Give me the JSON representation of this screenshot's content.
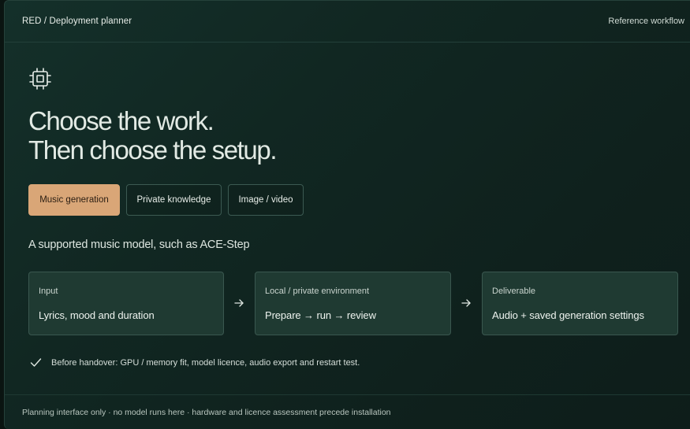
{
  "header": {
    "brand": "RED / Deployment planner",
    "nav_link": "Reference workflow"
  },
  "icons": {
    "hero": "cpu-chip-icon",
    "flow_arrow": "arrow-right-icon",
    "check": "checkmark-icon"
  },
  "hero": {
    "line1": "Choose the work.",
    "line2": "Then choose the setup."
  },
  "tabs": [
    {
      "label": "Music generation",
      "active": true
    },
    {
      "label": "Private knowledge",
      "active": false
    },
    {
      "label": "Image / video",
      "active": false
    }
  ],
  "model_line": "A supported music model, such as ACE-Step",
  "flow": [
    {
      "label": "Input",
      "value": "Lyrics, mood and duration"
    },
    {
      "label": "Local / private environment",
      "value": "Prepare → run → review"
    },
    {
      "label": "Deliverable",
      "value": "Audio + saved generation settings"
    }
  ],
  "checklist": "Before handover: GPU / memory fit, model licence, audio export and restart test.",
  "footer": "Planning interface only · no model runs here · hardware and licence assessment precede installation",
  "colors": {
    "accent": "#d9a677",
    "card_bg": "#1f3a32",
    "panel_bg": "#112722"
  }
}
